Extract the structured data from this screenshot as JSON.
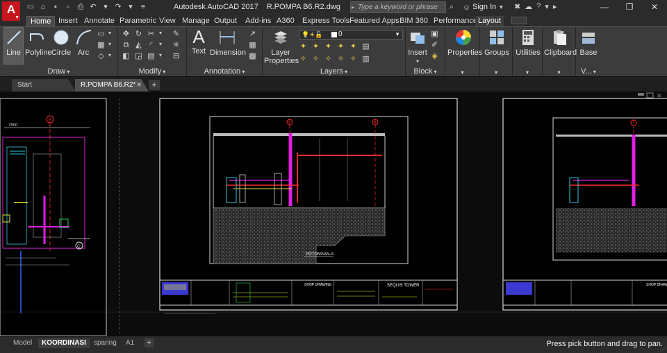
{
  "app": {
    "logo_letter": "A",
    "title": "Autodesk AutoCAD 2017",
    "filename": "R.POMPA B6.R2.dwg"
  },
  "search": {
    "placeholder": "Type a keyword or phrase"
  },
  "signin_label": "Sign In",
  "window_controls": {
    "minimize": "—",
    "restore": "❐",
    "close": "✕"
  },
  "ribbon_tabs": [
    "Home",
    "Insert",
    "Annotate",
    "Parametric",
    "View",
    "Manage",
    "Output",
    "Add-ins",
    "A360",
    "Express Tools",
    "Featured Apps",
    "BIM 360",
    "Performance",
    "Layout"
  ],
  "ribbon": {
    "draw": {
      "title": "Draw",
      "line": "Line",
      "polyline": "Polyline",
      "circle": "Circle",
      "arc": "Arc"
    },
    "modify": {
      "title": "Modify"
    },
    "annotation": {
      "title": "Annotation",
      "text": "Text",
      "dimension": "Dimension"
    },
    "layers": {
      "title": "Layers",
      "layer_properties_1": "Layer",
      "layer_properties_2": "Properties",
      "current_layer": "0"
    },
    "block": {
      "title": "Block",
      "insert": "Insert"
    },
    "properties": {
      "label": "Properties"
    },
    "groups": {
      "label": "Groups"
    },
    "utilities": {
      "label": "Utilities"
    },
    "clipboard": {
      "label": "Clipboard"
    },
    "view": {
      "base": "Base",
      "title": "V..."
    }
  },
  "file_tabs": {
    "start": "Start",
    "document": "R.POMPA B6.R2*",
    "add": "+"
  },
  "drawing": {
    "section_label": "POTONGAN-A",
    "title_block_heading": "SHOP DRAWING",
    "project_name": "SEQUIS TOWER",
    "left_tag": "7500",
    "grid_marks": [
      "B",
      "C",
      "E"
    ]
  },
  "layout_tabs": [
    "Model",
    "KOORDINASI",
    "sparing",
    "A1"
  ],
  "active_layout": "KOORDINASI",
  "status_message": "Press pick button and drag to pan.",
  "colors": {
    "accent_red": "#c4161c",
    "drawing_red": "#ff2a2a",
    "drawing_magenta": "#e020e0",
    "drawing_yellow": "#e8e82a",
    "drawing_cyan": "#30c8e0"
  }
}
